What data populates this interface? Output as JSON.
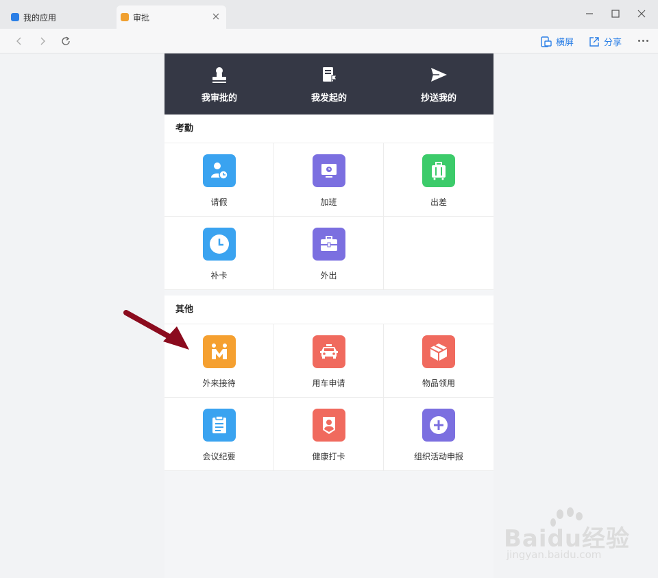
{
  "browser": {
    "tabs": [
      {
        "label": "我的应用",
        "active": false,
        "favicon_color": "#2b7fe6"
      },
      {
        "label": "审批",
        "active": true,
        "favicon_color": "#f0a030"
      }
    ],
    "actions": {
      "landscape": "横屏",
      "share": "分享"
    }
  },
  "app": {
    "top_nav": [
      {
        "label": "我审批的",
        "icon": "stamp-icon"
      },
      {
        "label": "我发起的",
        "icon": "document-flag-icon"
      },
      {
        "label": "抄送我的",
        "icon": "send-icon"
      }
    ],
    "sections": [
      {
        "title": "考勤",
        "items": [
          {
            "label": "请假",
            "icon": "leave-icon",
            "color": "#3aa3f0"
          },
          {
            "label": "加班",
            "icon": "overtime-icon",
            "color": "#7b6fe0"
          },
          {
            "label": "出差",
            "icon": "suitcase-icon",
            "color": "#3ccb6a"
          },
          {
            "label": "补卡",
            "icon": "clock-icon",
            "color": "#3aa3f0"
          },
          {
            "label": "外出",
            "icon": "briefcase-icon",
            "color": "#7b6fe0"
          }
        ]
      },
      {
        "title": "其他",
        "items": [
          {
            "label": "外来接待",
            "icon": "reception-icon",
            "color": "#f5a030"
          },
          {
            "label": "用车申请",
            "icon": "car-icon",
            "color": "#f06a5e"
          },
          {
            "label": "物品领用",
            "icon": "box-icon",
            "color": "#f06a5e"
          },
          {
            "label": "会议纪要",
            "icon": "clipboard-icon",
            "color": "#3aa3f0"
          },
          {
            "label": "健康打卡",
            "icon": "health-badge-icon",
            "color": "#f06a5e"
          },
          {
            "label": "组织活动申报",
            "icon": "plus-circle-icon",
            "color": "#7b6fe0"
          }
        ]
      }
    ]
  },
  "watermark": {
    "brand": "Baidu经验",
    "url": "jingyan.baidu.com"
  }
}
